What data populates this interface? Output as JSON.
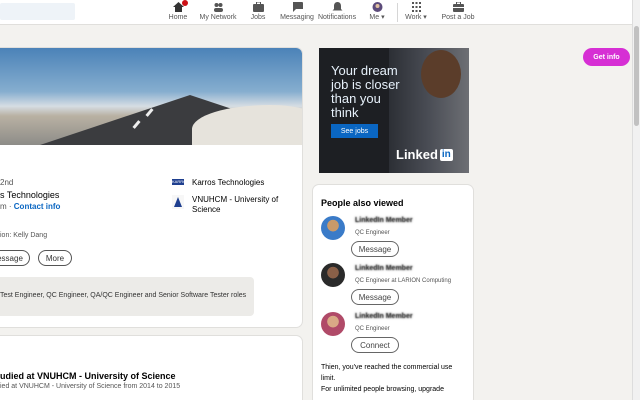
{
  "nav": {
    "items": [
      {
        "label": "Home",
        "icon": "home-icon"
      },
      {
        "label": "My Network",
        "icon": "network-icon"
      },
      {
        "label": "Jobs",
        "icon": "jobs-icon"
      },
      {
        "label": "Messaging",
        "icon": "messaging-icon"
      },
      {
        "label": "Notifications",
        "icon": "bell-icon"
      },
      {
        "label": "Me ▾",
        "icon": "avatar"
      },
      {
        "label": "Work ▾",
        "icon": "grid-icon"
      },
      {
        "label": "Post a Job",
        "icon": "briefcase-icon"
      }
    ]
  },
  "profile": {
    "degree": "2nd",
    "headline": "s Technologies",
    "contact_prefix": "m · ",
    "contact_link": "Contact info",
    "company": "Karros Technologies",
    "school_line1": "VNUHCM - University of",
    "school_line2": "Science",
    "mutual": "ion: Kelly Dang",
    "message_label": "essage",
    "more_label": "More",
    "open_to": "Test Engineer, QC Engineer, QA/QC Engineer and Senior Software Tester roles"
  },
  "activity": {
    "title": "udied at VNUHCM - University of Science",
    "subtitle": "ied at VNUHCM - University of Science from 2014 to 2015"
  },
  "ad": {
    "text": "Your dream job is closer than you think",
    "button": "See jobs",
    "logo": "Linked",
    "logo_in": "in"
  },
  "people": {
    "title": "People also viewed",
    "items": [
      {
        "name": "LinkedIn Member",
        "headline": "QC Engineer",
        "action": "Message"
      },
      {
        "name": "LinkedIn Member",
        "headline": "QC Engineer at LARION Computing",
        "action": "Message"
      },
      {
        "name": "LinkedIn Member",
        "headline": "QC Engineer",
        "action": "Connect"
      }
    ],
    "limit_line1": "Thien, you've reached the commercial use",
    "limit_line2": "limit.",
    "limit_line3": "For unlimited people browsing, upgrade"
  },
  "extension": {
    "label": "Get info",
    "color": "#d62fd4"
  },
  "colors": {
    "brand": "#0a66c2",
    "badge": "#cc1016"
  }
}
